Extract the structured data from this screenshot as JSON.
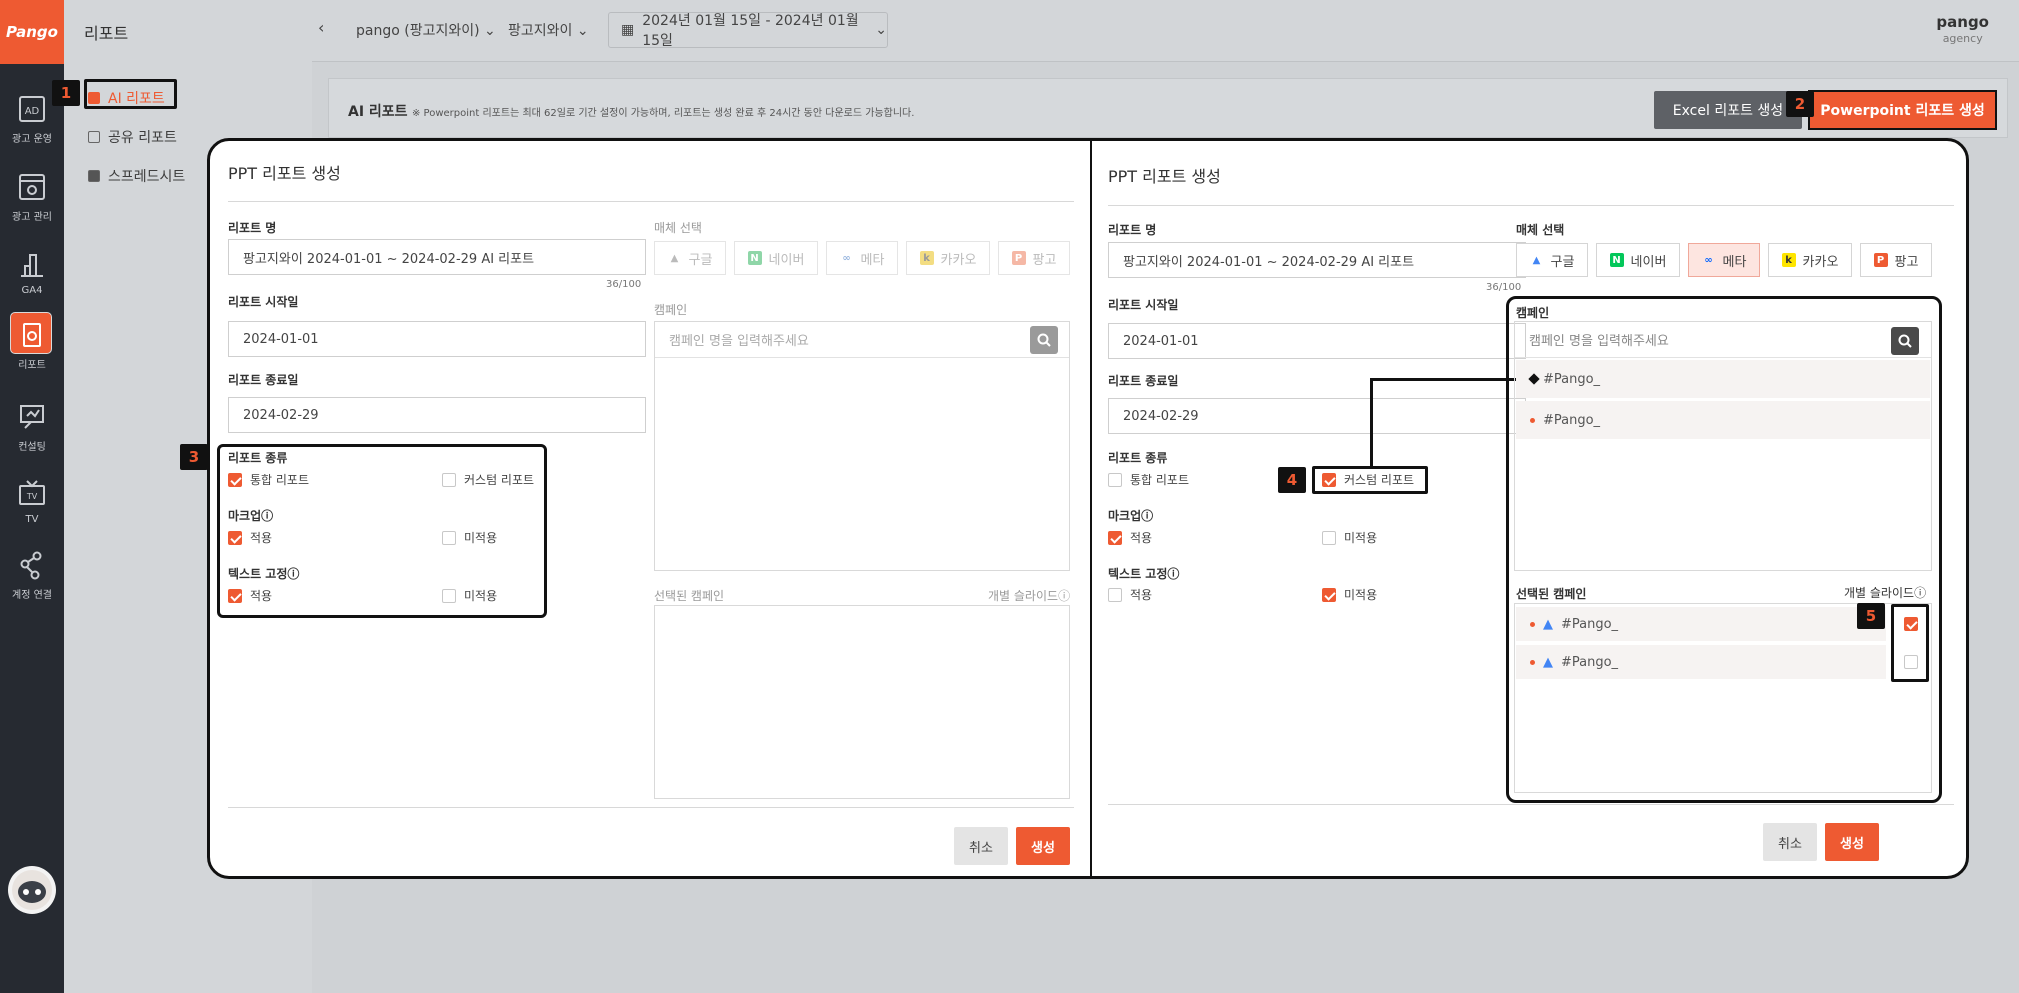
{
  "app": {
    "logo_text": "Pango"
  },
  "rail": {
    "items": [
      {
        "label": "광고 운영",
        "icon": "ad-icon"
      },
      {
        "label": "광고 관리",
        "icon": "gear-window-icon"
      },
      {
        "label": "GA4",
        "icon": "bar-chart-icon"
      },
      {
        "label": "리포트",
        "icon": "report-icon"
      },
      {
        "label": "컨설팅",
        "icon": "consulting-icon"
      },
      {
        "label": "TV",
        "icon": "tv-icon"
      },
      {
        "label": "계정 연결",
        "icon": "share-icon"
      }
    ]
  },
  "sidebar": {
    "title": "리포트",
    "items": [
      "AI 리포트",
      "공유 리포트",
      "스프레드시트"
    ]
  },
  "topbar": {
    "account": "pango (팡고지와이)",
    "brand": "팡고지와이",
    "date_range": "2024년 01월 15일 - 2024년 01월 15일",
    "user": "pango",
    "role": "agency"
  },
  "page": {
    "title": "AI 리포트",
    "note": "※ Powerpoint 리포트는 최대 62일로 기간 설정이 가능하며, 리포트는 생성 완료 후 24시간 동안 다운로드 가능합니다.",
    "excel_btn": "Excel 리포트 생성",
    "ppt_btn": "Powerpoint 리포트 생성"
  },
  "markers": [
    "1",
    "2",
    "3",
    "4",
    "5"
  ],
  "dialog": {
    "title": "PPT 리포트 생성",
    "name_label": "리포트 명",
    "name_value": "팡고지와이 2024-01-01 ~ 2024-02-29 AI 리포트",
    "name_count": "36/100",
    "start_label": "리포트 시작일",
    "start_value": "2024-01-01",
    "end_label": "리포트 종료일",
    "end_value": "2024-02-29",
    "type_label": "리포트 종류",
    "type_opt1": "통합 리포트",
    "type_opt2": "커스텀 리포트",
    "markup_label": "마크업",
    "text_label": "텍스트 고정",
    "apply": "적용",
    "not_apply": "미적용",
    "media_label": "매체 선택",
    "media": [
      "구글",
      "네이버",
      "메타",
      "카카오",
      "팡고"
    ],
    "campaign_label": "캠페인",
    "campaign_placeholder": "캠페인 명을 입력해주세요",
    "campaign_items": [
      "#Pango_",
      "#Pango_"
    ],
    "selected_label": "선택된 캠페인",
    "slide_label": "개별 슬라이드",
    "selected_items": [
      "#Pango_",
      "#Pango_"
    ],
    "cancel": "취소",
    "create": "생성"
  },
  "colors": {
    "accent": "#ee5a32",
    "rail": "#262a31",
    "overlay": "#cfd2d5"
  }
}
